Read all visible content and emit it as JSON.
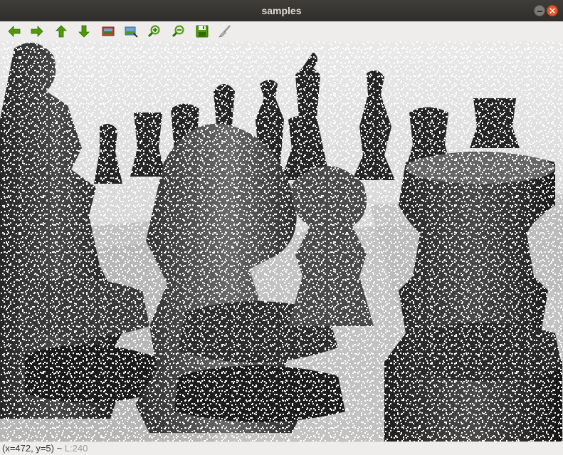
{
  "window": {
    "title": "samples",
    "close_glyph": "×"
  },
  "toolbar": {
    "buttons": [
      {
        "name": "pan-left-button",
        "icon": "arrow-left-icon"
      },
      {
        "name": "pan-right-button",
        "icon": "arrow-right-icon"
      },
      {
        "name": "pan-up-button",
        "icon": "arrow-up-icon"
      },
      {
        "name": "pan-down-button",
        "icon": "arrow-down-icon"
      },
      {
        "name": "zoom-reset-button",
        "icon": "image-icon"
      },
      {
        "name": "zoom-fit-button",
        "icon": "image-fit-icon"
      },
      {
        "name": "zoom-in-button",
        "icon": "zoom-in-icon"
      },
      {
        "name": "zoom-out-button",
        "icon": "zoom-out-icon"
      },
      {
        "name": "save-button",
        "icon": "floppy-disk-icon"
      },
      {
        "name": "properties-button",
        "icon": "brush-icon"
      }
    ],
    "accent_green": "#4e9a06"
  },
  "image": {
    "description_icon": "grayscale-chess-pieces-noise-image"
  },
  "status": {
    "coords": "(x=472, y=5) ~ ",
    "luminance": "L:240"
  }
}
